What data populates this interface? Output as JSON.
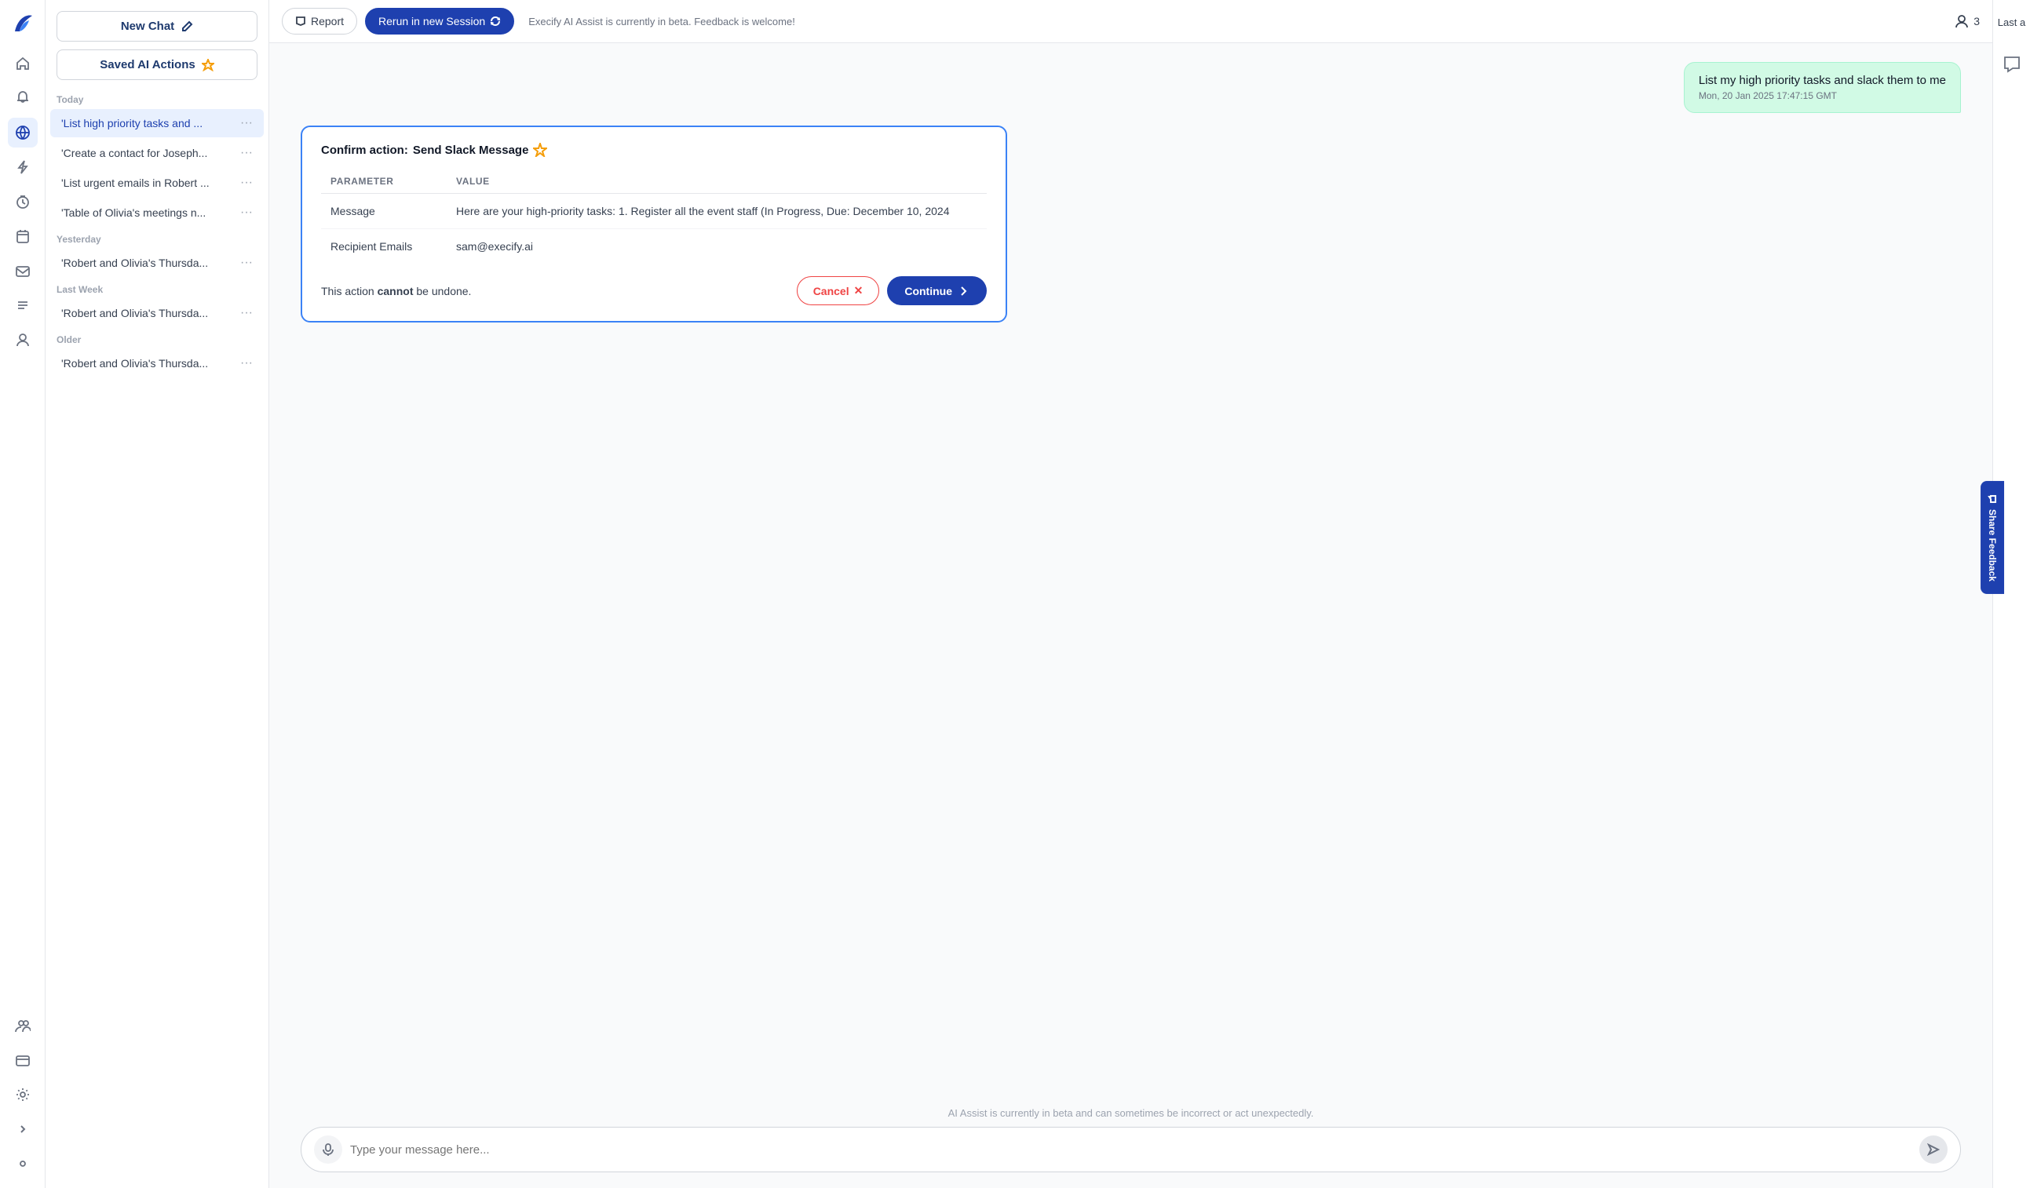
{
  "app": {
    "logo_text": "🪶",
    "title": "Execify AI Assist"
  },
  "topbar": {
    "report_label": "Report",
    "rerun_label": "Rerun in new Session",
    "beta_notice": "Execify AI Assist is currently in beta. Feedback is welcome!",
    "user_count": "3",
    "last_label": "Last a"
  },
  "sidebar": {
    "new_chat_label": "New Chat",
    "saved_actions_label": "Saved AI Actions",
    "sections": [
      {
        "label": "Today",
        "items": [
          {
            "text": "'List high priority tasks and ...",
            "active": true
          },
          {
            "text": "'Create a contact for Joseph..."
          },
          {
            "text": "'List urgent emails in Robert ..."
          },
          {
            "text": "'Table of Olivia's meetings n..."
          }
        ]
      },
      {
        "label": "Yesterday",
        "items": [
          {
            "text": "'Robert and Olivia's Thursda..."
          }
        ]
      },
      {
        "label": "Last Week",
        "items": [
          {
            "text": "'Robert and Olivia's Thursda..."
          }
        ]
      },
      {
        "label": "Older",
        "items": [
          {
            "text": "'Robert and Olivia's Thursda..."
          }
        ]
      }
    ]
  },
  "chat": {
    "user_message": {
      "text": "List my high priority tasks and slack them to me",
      "timestamp": "Mon, 20 Jan 2025 17:47:15 GMT"
    },
    "confirm_card": {
      "label": "Confirm action:",
      "action_name": "Send Slack Message",
      "columns": {
        "parameter": "PARAMETER",
        "value": "VALUE"
      },
      "rows": [
        {
          "parameter": "Message",
          "value": "Here are your high-priority tasks: 1. Register all the event staff (In Progress, Due: December 10, 2024"
        },
        {
          "parameter": "Recipient Emails",
          "value": "sam@execify.ai"
        }
      ],
      "warning": "This action cannot be undone.",
      "warning_bold": "cannot",
      "cancel_label": "Cancel",
      "continue_label": "Continue"
    },
    "footer_note": "AI Assist is currently in beta and can sometimes be incorrect or act unexpectedly.",
    "input_placeholder": "Type your message here..."
  },
  "feedback": {
    "label": "Share Feedback"
  },
  "nav_icons": {
    "home": "⌂",
    "bell": "🔔",
    "globe": "🌐",
    "lightning": "⚡",
    "clock": "🕐",
    "calendar": "📅",
    "mail": "✉",
    "list": "☰",
    "contacts": "👤",
    "team": "👥",
    "card": "💳",
    "settings": "⚙",
    "expand": "›",
    "collapse": "‹",
    "microphone": "🎤",
    "send": "➤",
    "chat_bubble": "💬"
  }
}
